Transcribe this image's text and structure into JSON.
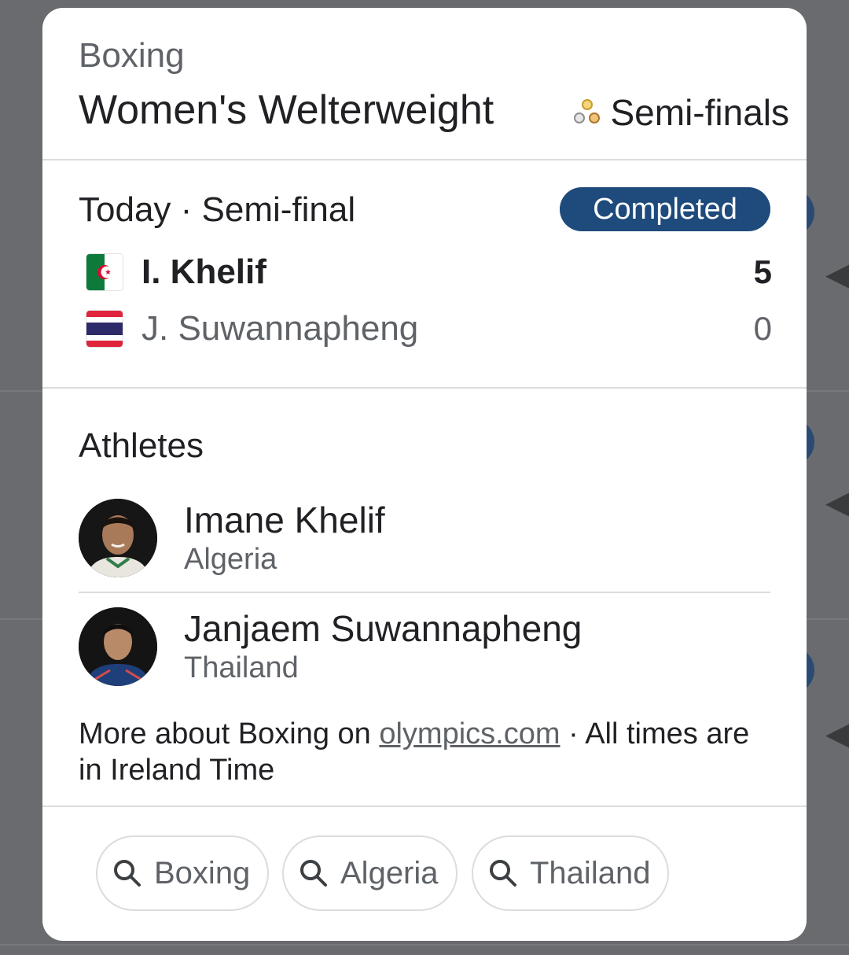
{
  "header": {
    "sport": "Boxing",
    "event": "Women's Welterweight",
    "stage_icon": "medals-icon",
    "stage": "Semi-finals"
  },
  "match": {
    "label": "Today · Semi-final",
    "status": "Completed",
    "competitors": [
      {
        "name": "I. Khelif",
        "score": "5",
        "flag": "algeria-flag-icon",
        "winner": true
      },
      {
        "name": "J. Suwannapheng",
        "score": "0",
        "flag": "thailand-flag-icon",
        "winner": false
      }
    ]
  },
  "athletes": {
    "heading": "Athletes",
    "items": [
      {
        "name": "Imane Khelif",
        "country": "Algeria"
      },
      {
        "name": "Janjaem Suwannapheng",
        "country": "Thailand"
      }
    ]
  },
  "footer": {
    "prefix": "More about Boxing on ",
    "link": "olympics.com",
    "suffix": " · All times are in Ireland Time"
  },
  "chips": [
    {
      "label": "Boxing",
      "icon": "search-icon"
    },
    {
      "label": "Algeria",
      "icon": "search-icon"
    },
    {
      "label": "Thailand",
      "icon": "search-icon"
    }
  ],
  "colors": {
    "badge": "#1e4a7c",
    "text_primary": "#202124",
    "text_secondary": "#5f6368"
  }
}
